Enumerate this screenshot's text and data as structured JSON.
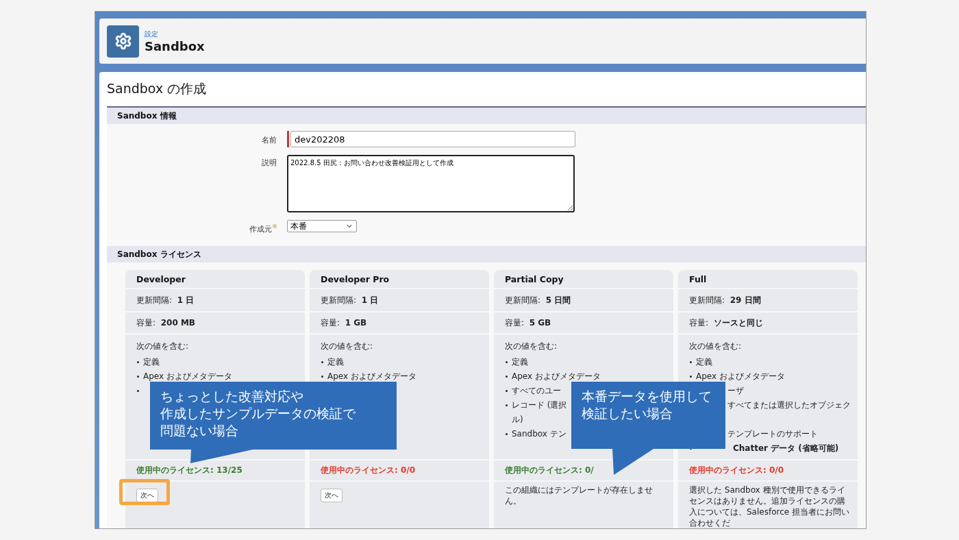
{
  "header": {
    "breadcrumb": "設定",
    "title": "Sandbox"
  },
  "page_title": "Sandbox の作成",
  "info_section": {
    "title": "Sandbox 情報",
    "fields": [
      {
        "kind": "text",
        "label": "名前",
        "value": "dev202208",
        "required": true
      },
      {
        "kind": "textarea",
        "label": "説明",
        "value": "2022.8.5 田尻：お問い合わせ改善検証用として作成"
      },
      {
        "kind": "select",
        "label": "作成元",
        "value": "本番"
      }
    ]
  },
  "license_section": {
    "title": "Sandbox ライセンス",
    "cards": [
      {
        "name": "Developer",
        "refresh_label": "更新間隔:",
        "refresh": "1 日",
        "capacity_label": "容量:",
        "capacity": "200 MB",
        "includes_label": "次の値を含む:",
        "items": [
          {
            "kind": "text",
            "text": "定義"
          },
          {
            "kind": "text",
            "text": "Apex およびメタデータ"
          },
          {
            "kind": "dot"
          }
        ],
        "license": {
          "text": "使用中のライセンス: 13/25",
          "available": true
        },
        "footer": {
          "kind": "button",
          "label": "次へ",
          "highlighted": true
        }
      },
      {
        "name": "Developer Pro",
        "refresh_label": "更新間隔:",
        "refresh": "1 日",
        "capacity_label": "容量:",
        "capacity": "1 GB",
        "includes_label": "次の値を含む:",
        "items": [
          {
            "kind": "text",
            "text": "定義"
          },
          {
            "kind": "text",
            "text": "Apex およびメタデータ"
          }
        ],
        "license": {
          "text": "使用中のライセンス: 0/0",
          "available": false
        },
        "footer": {
          "kind": "button",
          "label": "次へ",
          "highlighted": false
        }
      },
      {
        "name": "Partial Copy",
        "refresh_label": "更新間隔:",
        "refresh": "5 日間",
        "capacity_label": "容量:",
        "capacity": "5 GB",
        "includes_label": "次の値を含む:",
        "items": [
          {
            "kind": "text",
            "text": "定義"
          },
          {
            "kind": "text",
            "text": "Apex およびメタデータ"
          },
          {
            "kind": "text",
            "text": "すべてのユー"
          },
          {
            "kind": "text",
            "text": "レコード (選択"
          },
          {
            "kind": "cont",
            "text": "ル)"
          },
          {
            "kind": "text",
            "text": "Sandbox テン"
          }
        ],
        "license": {
          "text": "使用中のライセンス: 0/",
          "available": true
        },
        "footer": {
          "kind": "text",
          "text": "この組織にはテンプレートが存在しません。"
        }
      },
      {
        "name": "Full",
        "refresh_label": "更新間隔:",
        "refresh": "29 日間",
        "capacity_label": "容量:",
        "capacity": "ソースと同じ",
        "includes_label": "次の値を含む:",
        "items": [
          {
            "kind": "text",
            "text": "定義"
          },
          {
            "kind": "text",
            "text": "Apex およびメタデータ"
          },
          {
            "kind": "tail",
            "text": "ーザ"
          },
          {
            "kind": "tail",
            "text": "すべてまたは選択したオブジェク"
          },
          {
            "kind": "hidden"
          },
          {
            "kind": "tail",
            "text": "テンプレートのサポート"
          },
          {
            "kind": "bold_tail",
            "text": "Chatter データ (省略可能)"
          }
        ],
        "license": {
          "text": "使用中のライセンス: 0/0",
          "available": false
        },
        "footer": {
          "kind": "text",
          "text": "選択した Sandbox 種別で使用できるライセンスはありません。追加ライセンスの購入については、Salesforce 担当者にお問い合わせくだ"
        }
      }
    ]
  },
  "callouts": [
    {
      "lines": [
        "ちょっとした改善対応や",
        "作成したサンプルデータの検証で",
        "問題ない場合"
      ]
    },
    {
      "lines": [
        "本番データを使用して",
        "検証したい場合"
      ]
    }
  ]
}
